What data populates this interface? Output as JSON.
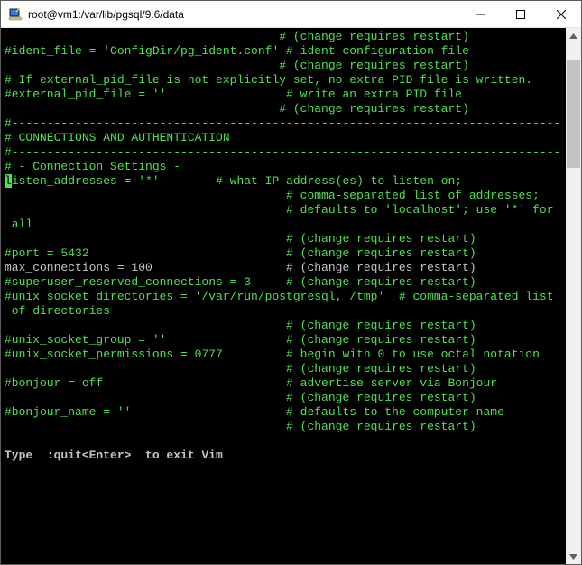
{
  "window": {
    "title": "root@vm1:/var/lib/pgsql/9.6/data"
  },
  "terminal": {
    "lines": [
      {
        "t": "                                       # (change requires restart)",
        "c": "g"
      },
      {
        "t": "#ident_file = 'ConfigDir/pg_ident.conf' # ident configuration file",
        "c": "g"
      },
      {
        "t": "                                       # (change requires restart)",
        "c": "g"
      },
      {
        "t": "",
        "c": "g"
      },
      {
        "t": "# If external_pid_file is not explicitly set, no extra PID file is written.",
        "c": "g"
      },
      {
        "t": "#external_pid_file = ''                 # write an extra PID file",
        "c": "g"
      },
      {
        "t": "                                       # (change requires restart)",
        "c": "g"
      },
      {
        "t": "",
        "c": "g"
      },
      {
        "t": "",
        "c": "g"
      },
      {
        "t": "#------------------------------------------------------------------------------",
        "c": "g"
      },
      {
        "t": "# CONNECTIONS AND AUTHENTICATION",
        "c": "g"
      },
      {
        "t": "#------------------------------------------------------------------------------",
        "c": "g"
      },
      {
        "t": "",
        "c": "g"
      },
      {
        "t": "# - Connection Settings -",
        "c": "g"
      },
      {
        "t": "",
        "c": "g"
      },
      {
        "cursor": "l",
        "t": "isten_addresses = '*'        # what IP address(es) to listen on;",
        "c": "g"
      },
      {
        "t": "                                        # comma-separated list of addresses;",
        "c": "g"
      },
      {
        "t": "                                        # defaults to 'localhost'; use '*' for",
        "c": "g"
      },
      {
        "t": " all",
        "c": "g"
      },
      {
        "t": "                                        # (change requires restart)",
        "c": "g"
      },
      {
        "t": "#port = 5432                            # (change requires restart)",
        "c": "g"
      },
      {
        "t": "max_connections = 100                   # (change requires restart)",
        "c": "w"
      },
      {
        "t": "#superuser_reserved_connections = 3     # (change requires restart)",
        "c": "g"
      },
      {
        "t": "#unix_socket_directories = '/var/run/postgresql, /tmp'  # comma-separated list",
        "c": "g"
      },
      {
        "t": " of directories",
        "c": "g"
      },
      {
        "t": "                                        # (change requires restart)",
        "c": "g"
      },
      {
        "t": "#unix_socket_group = ''                 # (change requires restart)",
        "c": "g"
      },
      {
        "t": "#unix_socket_permissions = 0777         # begin with 0 to use octal notation",
        "c": "g"
      },
      {
        "t": "                                        # (change requires restart)",
        "c": "g"
      },
      {
        "t": "#bonjour = off                          # advertise server via Bonjour",
        "c": "g"
      },
      {
        "t": "                                        # (change requires restart)",
        "c": "g"
      },
      {
        "t": "#bonjour_name = ''                      # defaults to the computer name",
        "c": "g"
      },
      {
        "t": "                                        # (change requires restart)",
        "c": "g"
      }
    ],
    "status": "Type  :quit<Enter>  to exit Vim"
  }
}
